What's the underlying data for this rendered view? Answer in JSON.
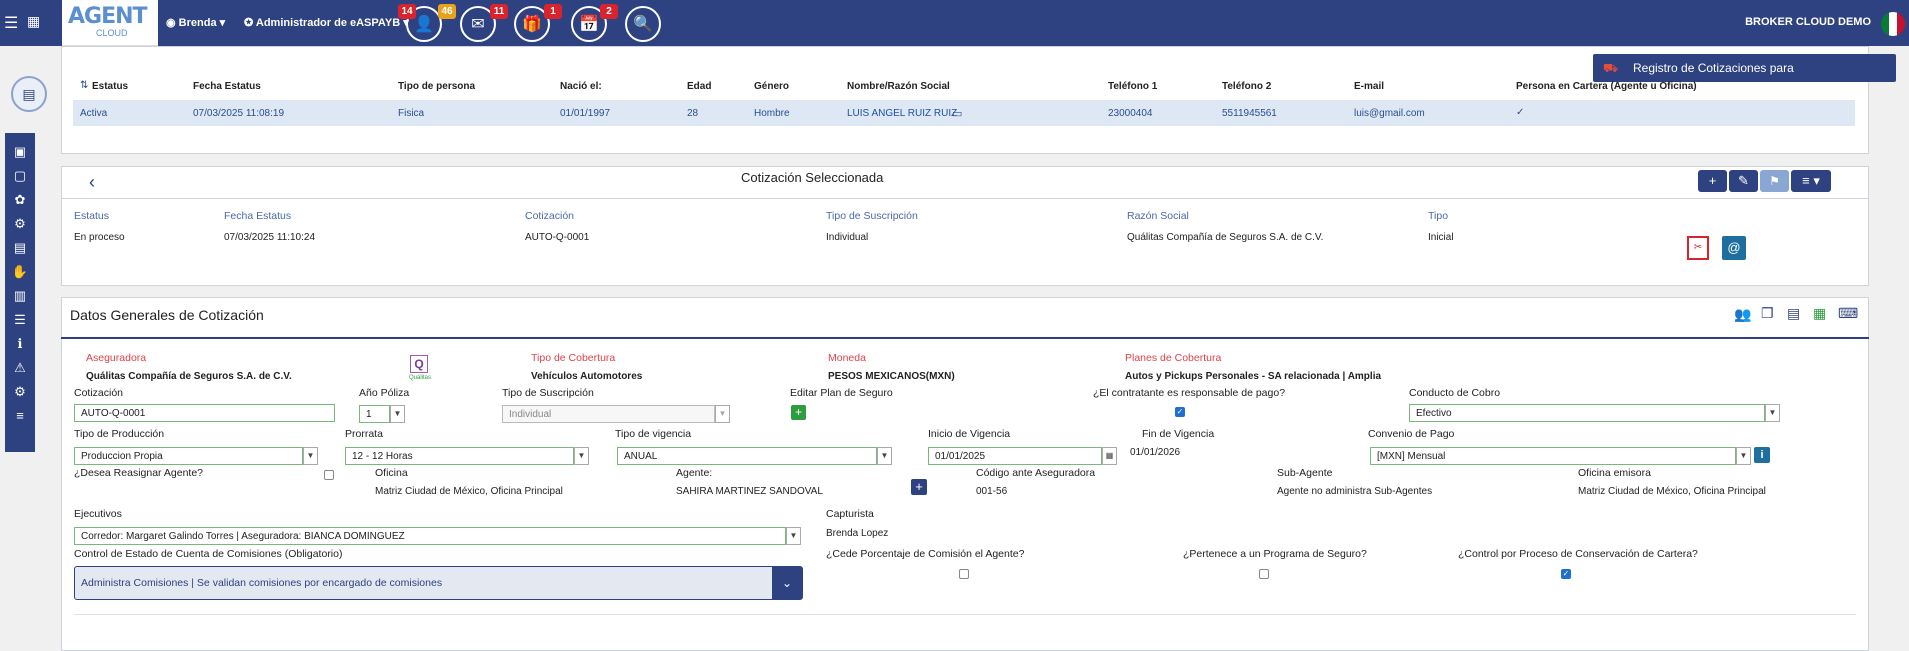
{
  "app": {
    "logo_main": "AGENT",
    "logo_sub": "CLOUD",
    "user_menu": "Brenda",
    "role_menu": "Administrador de eASPAYB",
    "broker": "BROKER CLOUD DEMO",
    "badges": {
      "agents": "14",
      "agents_alt": "46",
      "mail": "11",
      "gifts": "1",
      "calendar": "2"
    }
  },
  "register_button": "Registro de Cotizaciones para ASEGURADORAS",
  "client_table": {
    "headers": [
      "Estatus",
      "Fecha Estatus",
      "Tipo de persona",
      "Nació el:",
      "Edad",
      "Género",
      "Nombre/Razón Social",
      "Teléfono 1",
      "Teléfono 2",
      "E-mail",
      "Persona en Cartera (Agente u Oficina)"
    ],
    "row": [
      "Activa",
      "07/03/2025 11:08:19",
      "Fisica",
      "01/01/1997",
      "28",
      "Hombre",
      "LUIS ANGEL RUIZ RUIZ",
      "23000404",
      "5511945561",
      "luis@gmail.com",
      "✓"
    ]
  },
  "quote": {
    "title": "Cotización Seleccionada",
    "headers": [
      "Estatus",
      "Fecha Estatus",
      "Cotización",
      "Tipo de Suscripción",
      "Razón Social",
      "Tipo"
    ],
    "values": [
      "En proceso",
      "07/03/2025 11:10:24",
      "AUTO-Q-0001",
      "Individual",
      "Quálitas Compañía de Seguros S.A. de C.V.",
      "Inicial"
    ]
  },
  "general": {
    "title": "Datos Generales de Cotización",
    "aseguradora_label": "Aseguradora",
    "aseguradora": "Quálitas Compañía de Seguros S.A. de C.V.",
    "insurer_logo_text": "Q",
    "insurer_logo_caption": "Quálitas",
    "cobertura_label": "Tipo de Cobertura",
    "cobertura": "Vehículos Automotores",
    "moneda_label": "Moneda",
    "moneda": "PESOS MEXICANOS(MXN)",
    "planes_label": "Planes de Cobertura",
    "planes": "Autos y Pickups Personales - SA relacionada | Amplia",
    "cotizacion_label": "Cotización",
    "cotizacion": "AUTO-Q-0001",
    "anio_label": "Año Póliza",
    "anio": "1",
    "suscripcion_label": "Tipo de Suscripción",
    "suscripcion": "Individual",
    "editar_plan_label": "Editar Plan de Seguro",
    "responsable_label": "¿El contratante es responsable de pago?",
    "conducto_label": "Conducto de Cobro",
    "conducto": "Efectivo",
    "produccion_label": "Tipo de Producción",
    "produccion": "Produccion Propia",
    "prorrata_label": "Prorrata",
    "prorrata": "12 - 12 Horas",
    "vigencia_label": "Tipo de vigencia",
    "vigencia": "ANUAL",
    "inicio_label": "Inicio de Vigencia",
    "inicio": "01/01/2025",
    "fin_label": "Fin de Vigencia",
    "fin": "01/01/2026",
    "convenio_label": "Convenio de Pago",
    "convenio": "[MXN] Mensual",
    "reasignar_label": "¿Desea Reasignar Agente?",
    "oficina_label": "Oficina",
    "oficina": "Matriz Ciudad de México, Oficina Principal",
    "agente_label": "Agente:",
    "agente": "SAHIRA MARTINEZ SANDOVAL",
    "codigo_label": "Código ante Aseguradora",
    "codigo": "001-56",
    "subagente_label": "Sub-Agente",
    "subagente": "Agente no administra Sub-Agentes",
    "emisora_label": "Oficina emisora",
    "emisora": "Matriz Ciudad de México, Oficina Principal",
    "ejecutivos_label": "Ejecutivos",
    "ejecutivos": "Corredor: Margaret Galindo Torres | Aseguradora: BIANCA DOMINGUEZ",
    "capturista_label": "Capturista",
    "capturista": "Brenda Lopez",
    "control_label": "Control de Estado de Cuenta de Comisiones (Obligatorio)",
    "control": "Administra Comisiones | Se validan comisiones por encargado de comisiones",
    "cede_label": "¿Cede Porcentaje de Comisión el Agente?",
    "programa_label": "¿Pertenece a un Programa de Seguro?",
    "conservacion_label": "¿Control por Proceso de Conservación de Cartera?"
  }
}
